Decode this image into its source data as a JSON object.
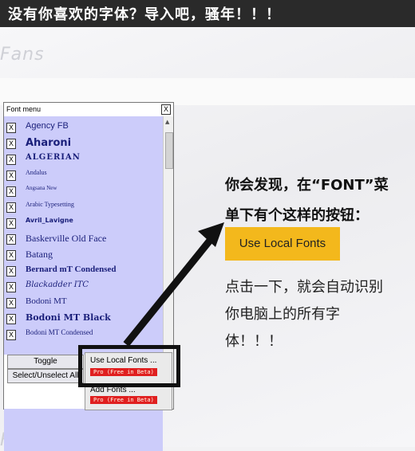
{
  "banner": {
    "title": "没有你喜欢的字体？导入吧，骚年！！！"
  },
  "watermark": "Fans",
  "font_menu": {
    "title": "Font menu",
    "close_glyph": "X",
    "check_glyph": "X",
    "fonts": [
      "Agency FB",
      "Aharoni",
      "ALGERIAN",
      "Andalus",
      "Angsana New",
      "Arabic Typesetting",
      "Avril_Lavigne",
      "Baskerville Old Face",
      "Batang",
      "Bernard mT Condensed",
      "Blackadder ITC",
      "Bodoni MT",
      "Bodoni MT Black",
      "Bodoni MT Condensed"
    ],
    "toggle_label": "Toggle",
    "select_all_label": "Select/Unselect All",
    "use_local_label": "Use Local Fonts ...",
    "add_fonts_label": "Add Fonts ...",
    "pro_tag": "Pro (Free in Beta)"
  },
  "right_text": {
    "line1": "你会发现，在“FONT”菜",
    "line2": "单下有个这样的按钮：",
    "button_label": "Use Local Fonts",
    "line3": "点击一下，就会自动识别",
    "line4": "你电脑上的所有字",
    "line5": "体！！！"
  },
  "colors": {
    "banner": "#2a2a2a",
    "list_bg": "#ccccfa",
    "button_yellow": "#f3b81c",
    "pro_tag": "#e02020"
  }
}
